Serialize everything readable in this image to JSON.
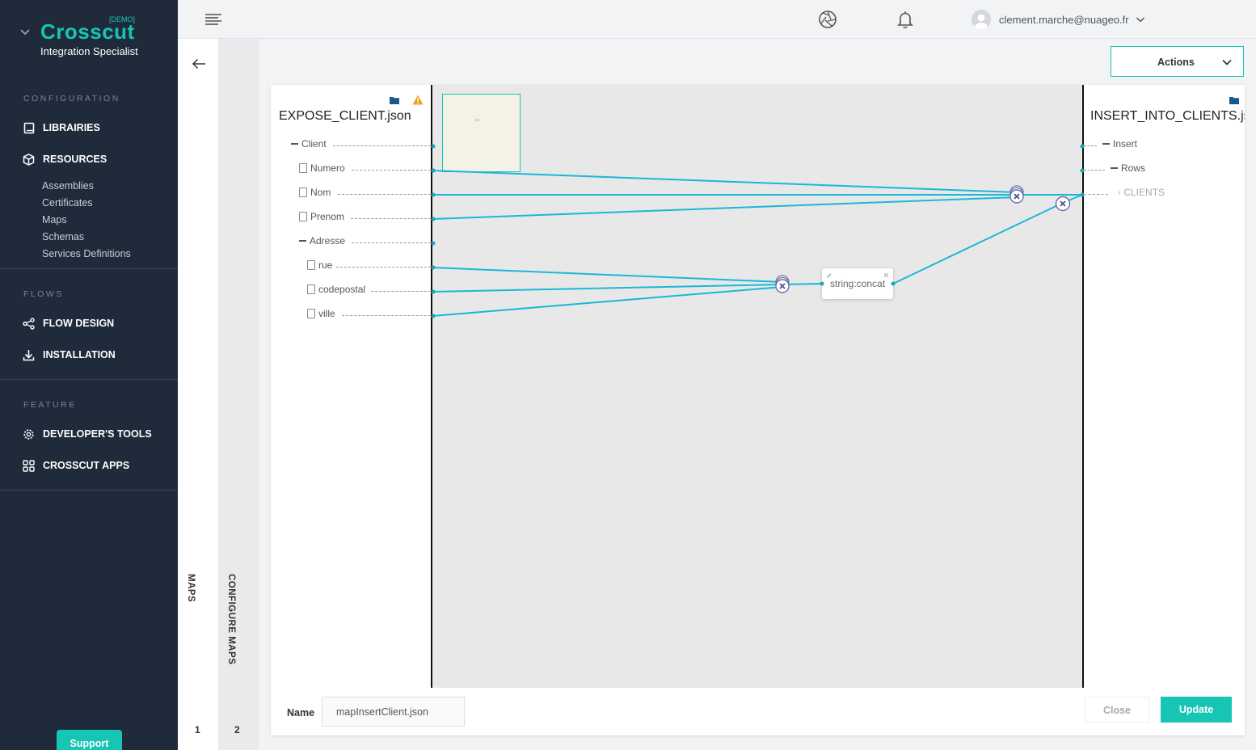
{
  "brand": {
    "demo_tag": "[DEMO]",
    "name": "Crosscut",
    "role": "Integration Specialist"
  },
  "sidebar": {
    "sections": [
      {
        "title": "CONFIGURATION"
      },
      {
        "title": "FLOWS"
      },
      {
        "title": "FEATURE"
      }
    ],
    "items": [
      {
        "label": "LIBRAIRIES",
        "icon": "book-icon"
      },
      {
        "label": "RESOURCES",
        "icon": "cube-icon"
      },
      {
        "label": "FLOW DESIGN",
        "icon": "share-icon"
      },
      {
        "label": "INSTALLATION",
        "icon": "download-icon"
      },
      {
        "label": "DEVELOPER'S TOOLS",
        "icon": "gear-icon"
      },
      {
        "label": "CROSSCUT APPS",
        "icon": "apps-grid-icon"
      }
    ],
    "resources_sub": [
      "Assemblies",
      "Certificates",
      "Maps",
      "Schemas",
      "Services Definitions"
    ],
    "support_label": "Support"
  },
  "topbar": {
    "user_email": "clement.marche@nuageo.fr"
  },
  "steps": {
    "step1_label": "MAPS",
    "step1_num": "1",
    "step2_label": "CONFIGURE MAPS",
    "step2_num": "2"
  },
  "actions_label": "Actions",
  "mapper": {
    "source": {
      "title": "EXPOSE_CLIENT.json",
      "nodes": [
        "Client",
        "Numero",
        "Nom",
        "Prenom",
        "Adresse",
        "rue",
        "codepostal",
        "ville"
      ]
    },
    "target": {
      "title": "INSERT_INTO_CLIENTS.json",
      "nodes": [
        "Insert",
        "Rows",
        "CLIENTS"
      ]
    },
    "function_label": "string:concat"
  },
  "footer": {
    "name_label": "Name",
    "name_value": "mapInsertClient.json",
    "close_label": "Close",
    "update_label": "Update"
  },
  "colors": {
    "accent": "#16c5b4",
    "sidebar_bg": "#1f2a3a",
    "link_line": "#1ab8d6"
  }
}
